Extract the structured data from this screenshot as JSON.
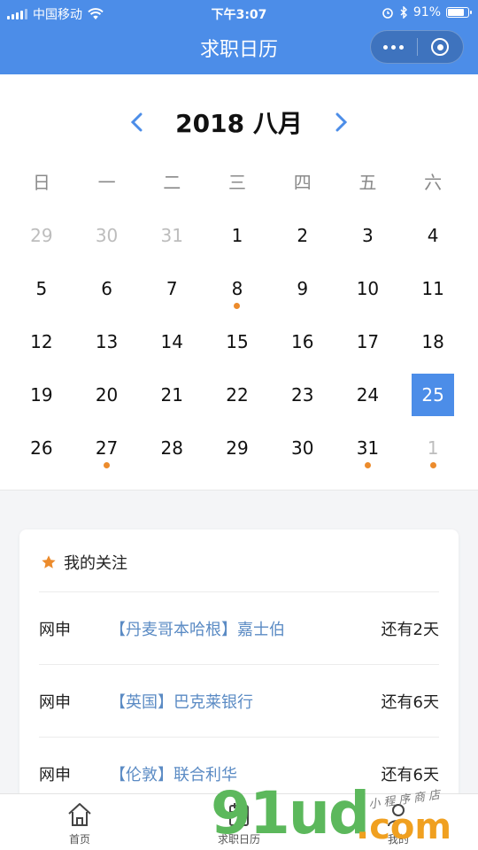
{
  "status_bar": {
    "carrier": "中国移动",
    "time": "下午3:07",
    "battery_text": "91%",
    "battery_level": 0.91
  },
  "nav": {
    "title": "求职日历"
  },
  "calendar": {
    "year_month": "2018 八月",
    "weekdays": [
      "日",
      "一",
      "二",
      "三",
      "四",
      "五",
      "六"
    ],
    "days": [
      {
        "label": "29",
        "muted": true,
        "dot": false,
        "selected": false
      },
      {
        "label": "30",
        "muted": true,
        "dot": false,
        "selected": false
      },
      {
        "label": "31",
        "muted": true,
        "dot": false,
        "selected": false
      },
      {
        "label": "1",
        "muted": false,
        "dot": false,
        "selected": false
      },
      {
        "label": "2",
        "muted": false,
        "dot": false,
        "selected": false
      },
      {
        "label": "3",
        "muted": false,
        "dot": false,
        "selected": false
      },
      {
        "label": "4",
        "muted": false,
        "dot": false,
        "selected": false
      },
      {
        "label": "5",
        "muted": false,
        "dot": false,
        "selected": false
      },
      {
        "label": "6",
        "muted": false,
        "dot": false,
        "selected": false
      },
      {
        "label": "7",
        "muted": false,
        "dot": false,
        "selected": false
      },
      {
        "label": "8",
        "muted": false,
        "dot": true,
        "selected": false
      },
      {
        "label": "9",
        "muted": false,
        "dot": false,
        "selected": false
      },
      {
        "label": "10",
        "muted": false,
        "dot": false,
        "selected": false
      },
      {
        "label": "11",
        "muted": false,
        "dot": false,
        "selected": false
      },
      {
        "label": "12",
        "muted": false,
        "dot": false,
        "selected": false
      },
      {
        "label": "13",
        "muted": false,
        "dot": false,
        "selected": false
      },
      {
        "label": "14",
        "muted": false,
        "dot": false,
        "selected": false
      },
      {
        "label": "15",
        "muted": false,
        "dot": false,
        "selected": false
      },
      {
        "label": "16",
        "muted": false,
        "dot": false,
        "selected": false
      },
      {
        "label": "17",
        "muted": false,
        "dot": false,
        "selected": false
      },
      {
        "label": "18",
        "muted": false,
        "dot": false,
        "selected": false
      },
      {
        "label": "19",
        "muted": false,
        "dot": false,
        "selected": false
      },
      {
        "label": "20",
        "muted": false,
        "dot": false,
        "selected": false
      },
      {
        "label": "21",
        "muted": false,
        "dot": false,
        "selected": false
      },
      {
        "label": "22",
        "muted": false,
        "dot": false,
        "selected": false
      },
      {
        "label": "23",
        "muted": false,
        "dot": false,
        "selected": false
      },
      {
        "label": "24",
        "muted": false,
        "dot": false,
        "selected": false
      },
      {
        "label": "25",
        "muted": false,
        "dot": false,
        "selected": true
      },
      {
        "label": "26",
        "muted": false,
        "dot": false,
        "selected": false
      },
      {
        "label": "27",
        "muted": false,
        "dot": true,
        "selected": false
      },
      {
        "label": "28",
        "muted": false,
        "dot": false,
        "selected": false
      },
      {
        "label": "29",
        "muted": false,
        "dot": false,
        "selected": false
      },
      {
        "label": "30",
        "muted": false,
        "dot": false,
        "selected": false
      },
      {
        "label": "31",
        "muted": false,
        "dot": true,
        "selected": false
      },
      {
        "label": "1",
        "muted": true,
        "dot": true,
        "selected": false
      }
    ]
  },
  "follow": {
    "title": "我的关注",
    "items": [
      {
        "type": "网申",
        "org": "【丹麦哥本哈根】嘉士伯",
        "days": "还有2天"
      },
      {
        "type": "网申",
        "org": "【英国】巴克莱银行",
        "days": "还有6天"
      },
      {
        "type": "网申",
        "org": "【伦敦】联合利华",
        "days": "还有6天"
      }
    ]
  },
  "tabbar": {
    "items": [
      {
        "label": "首页",
        "icon": "home-icon"
      },
      {
        "label": "求职日历",
        "icon": "calendar-icon"
      },
      {
        "label": "我的",
        "icon": "user-icon"
      }
    ]
  },
  "watermark": {
    "big": "91ud",
    "com": ".com",
    "small": "小程序商店"
  },
  "colors": {
    "primary": "#4c8de8",
    "dot": "#ec8b2c",
    "link": "#5b8bc4",
    "star": "#ec8b2c"
  }
}
